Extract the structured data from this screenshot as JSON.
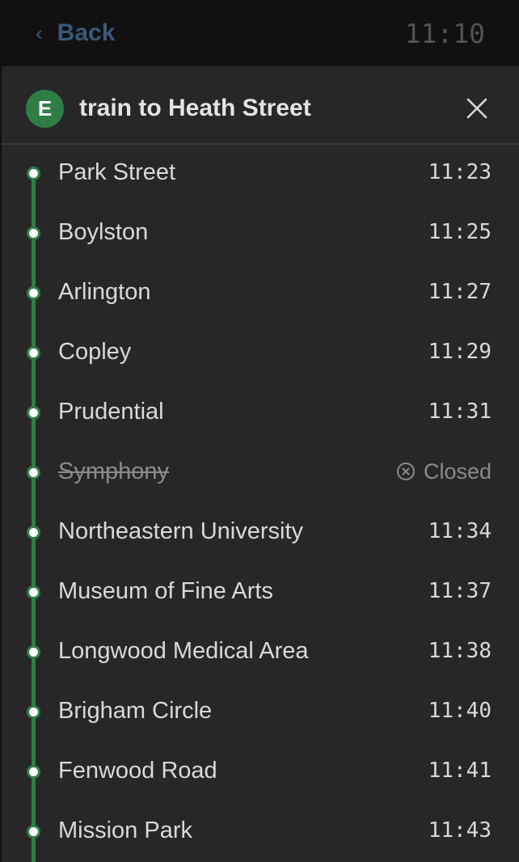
{
  "topbar": {
    "back_label": "Back",
    "clock": "11:10"
  },
  "trip": {
    "route_letter": "E",
    "title": "train to Heath Street",
    "route_color": "#2f7d45"
  },
  "stops": [
    {
      "name": "Park Street",
      "time": "11:23"
    },
    {
      "name": "Boylston",
      "time": "11:25"
    },
    {
      "name": "Arlington",
      "time": "11:27"
    },
    {
      "name": "Copley",
      "time": "11:29"
    },
    {
      "name": "Prudential",
      "time": "11:31"
    },
    {
      "name": "Symphony",
      "status": "Closed"
    },
    {
      "name": "Northeastern University",
      "time": "11:34"
    },
    {
      "name": "Museum of Fine Arts",
      "time": "11:37"
    },
    {
      "name": "Longwood Medical Area",
      "time": "11:38"
    },
    {
      "name": "Brigham Circle",
      "time": "11:40"
    },
    {
      "name": "Fenwood Road",
      "time": "11:41"
    },
    {
      "name": "Mission Park",
      "time": "11:43"
    }
  ]
}
